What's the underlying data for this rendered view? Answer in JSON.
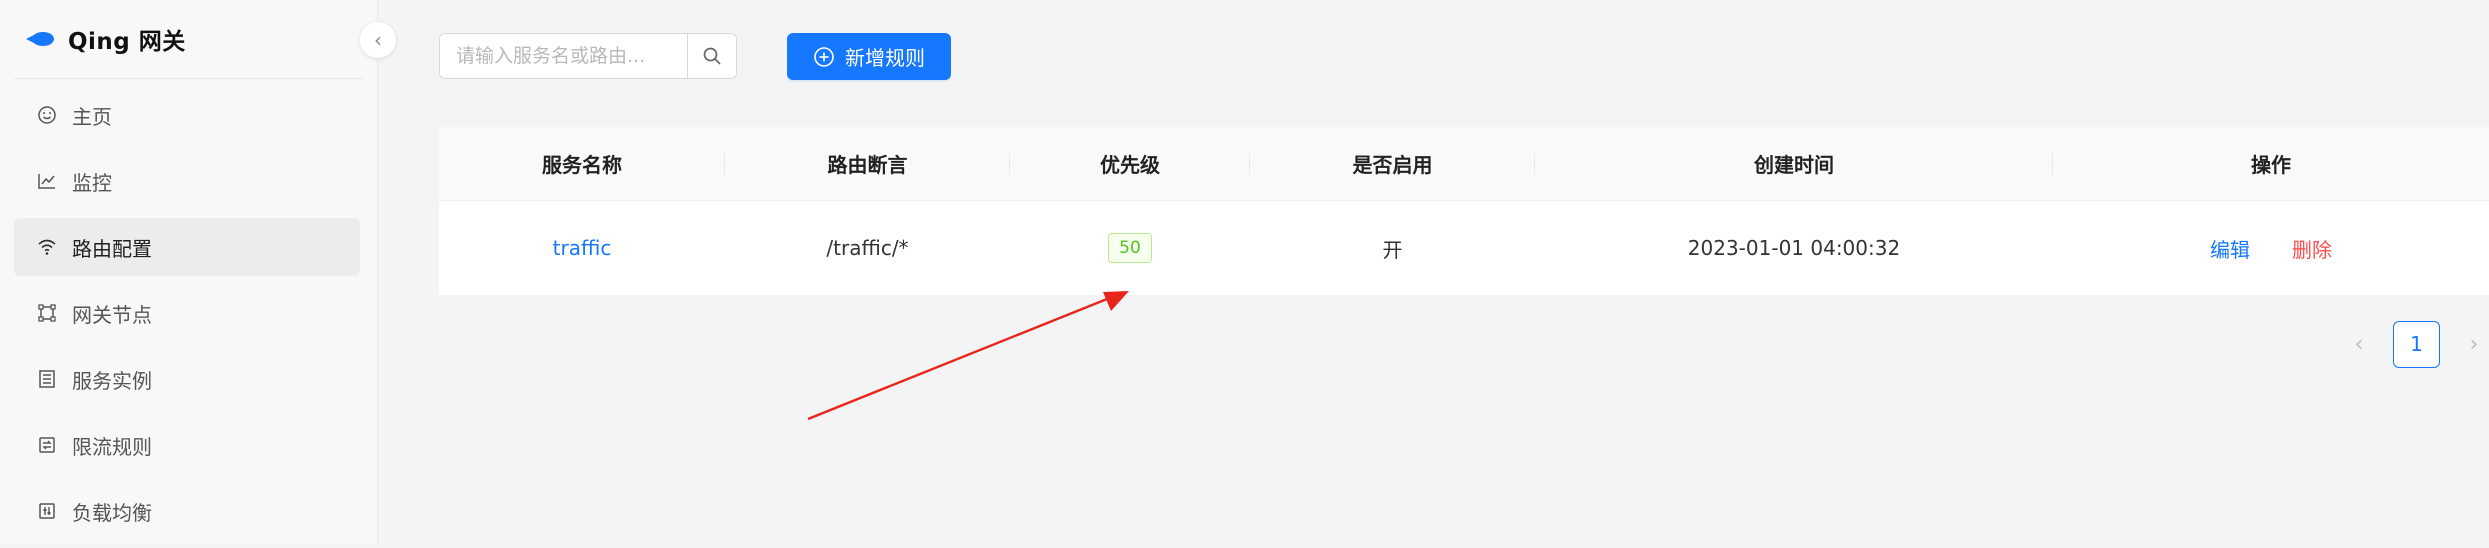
{
  "brand": {
    "title": "Qing 网关"
  },
  "sidebar": {
    "items": [
      {
        "label": "主页",
        "icon": "smile-icon",
        "active": false
      },
      {
        "label": "监控",
        "icon": "line-chart-icon",
        "active": false
      },
      {
        "label": "路由配置",
        "icon": "wifi-icon",
        "active": true
      },
      {
        "label": "网关节点",
        "icon": "node-icon",
        "active": false
      },
      {
        "label": "服务实例",
        "icon": "instance-icon",
        "active": false
      },
      {
        "label": "限流规则",
        "icon": "rate-limit-icon",
        "active": false
      },
      {
        "label": "负载均衡",
        "icon": "balance-icon",
        "active": false
      }
    ]
  },
  "toolbar": {
    "search_placeholder": "请输入服务名或路由...",
    "add_label": "新增规则"
  },
  "table": {
    "columns": [
      "服务名称",
      "路由断言",
      "优先级",
      "是否启用",
      "创建时间",
      "操作"
    ],
    "rows": [
      {
        "service": "traffic",
        "route": "/traffic/*",
        "priority": "50",
        "enabled": "开",
        "created": "2023-01-01 04:00:32",
        "edit": "编辑",
        "delete": "删除"
      }
    ]
  },
  "pagination": {
    "current": "1"
  },
  "colors": {
    "accent": "#1677ff",
    "danger": "#ff4d4f",
    "success": "#52c41a",
    "annotation": "#e8251a"
  }
}
